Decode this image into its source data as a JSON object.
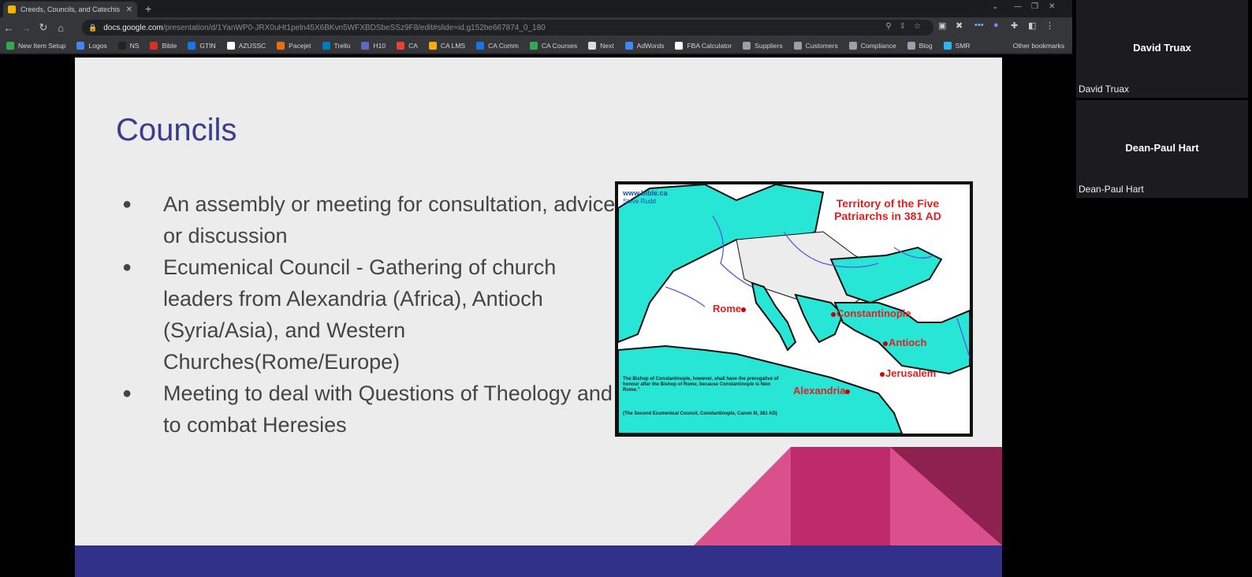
{
  "browser": {
    "tab_title": "Creeds, Councils, and Catechis",
    "url_host": "docs.google.com",
    "url_path": "/presentation/d/1YanWP0-JRX0uHt1peln45X6BKvn5WFXBDSbeSSz9F8/edit#slide=id.g152be667874_0_180",
    "bookmarks": [
      {
        "label": "New Item Setup",
        "color": "#34a853"
      },
      {
        "label": "Logos",
        "color": "#4285f4"
      },
      {
        "label": "NS",
        "color": "#222222"
      },
      {
        "label": "Bible",
        "color": "#d93025"
      },
      {
        "label": "GTIN",
        "color": "#1a73e8"
      },
      {
        "label": "AZUSSC",
        "color": "#ffffff"
      },
      {
        "label": "Pacejet",
        "color": "#e8710a"
      },
      {
        "label": "Trello",
        "color": "#0079bf"
      },
      {
        "label": "H10",
        "color": "#5c6bc0"
      },
      {
        "label": "CA",
        "color": "#ea4335"
      },
      {
        "label": "CA LMS",
        "color": "#f9ab00"
      },
      {
        "label": "CA Comm",
        "color": "#1a73e8"
      },
      {
        "label": "CA Courses",
        "color": "#34a853"
      },
      {
        "label": "Next",
        "color": "#dddddd"
      },
      {
        "label": "AdWords",
        "color": "#4285f4"
      },
      {
        "label": "FBA Calculator",
        "color": "#ffffff"
      },
      {
        "label": "Suppliers",
        "color": "#9aa0a6"
      },
      {
        "label": "Customers",
        "color": "#9aa0a6"
      },
      {
        "label": "Compliance",
        "color": "#9aa0a6"
      },
      {
        "label": "Blog",
        "color": "#9aa0a6"
      },
      {
        "label": "SMR",
        "color": "#29b6f6"
      }
    ],
    "other_bookmarks": "Other bookmarks"
  },
  "slide": {
    "title": "Councils",
    "bullets": [
      "An assembly or meeting for consultation, advice, or discussion",
      "Ecumenical Council - Gathering of church leaders from Alexandria (Africa), Antioch (Syria/Asia), and Western Churches(Rome/Europe)",
      "Meeting to deal with Questions of Theology and to combat Heresies"
    ],
    "map": {
      "brand": "www.bible.ca",
      "brand_sub": "Steve Rudd",
      "title": "Territory of the Five Patriarchs in 381 AD",
      "cities": {
        "rome": "Rome",
        "constantinople": "Constantinople",
        "antioch": "Antioch",
        "jerusalem": "Jerusalem",
        "alexandria": "Alexandria"
      },
      "note": "The Bishop of Constantinople, however, shall have the prerogative of honour after the Bishop of Rome, because Constantinople is New Rome.\"",
      "citation": "(The Second Ecumenical Council, Constantinople, Canon III, 381 AD)"
    },
    "colors": {
      "title": "#3a3d8f",
      "footer": "#31318a",
      "deco_light": "#d9508c",
      "deco_mid": "#bf2a6a",
      "deco_dark": "#8e2150",
      "land": "#27e6d6"
    }
  },
  "participants": [
    {
      "name": "David Truax",
      "label": "David Truax"
    },
    {
      "name": "Dean-Paul Hart",
      "label": "Dean-Paul Hart"
    }
  ]
}
